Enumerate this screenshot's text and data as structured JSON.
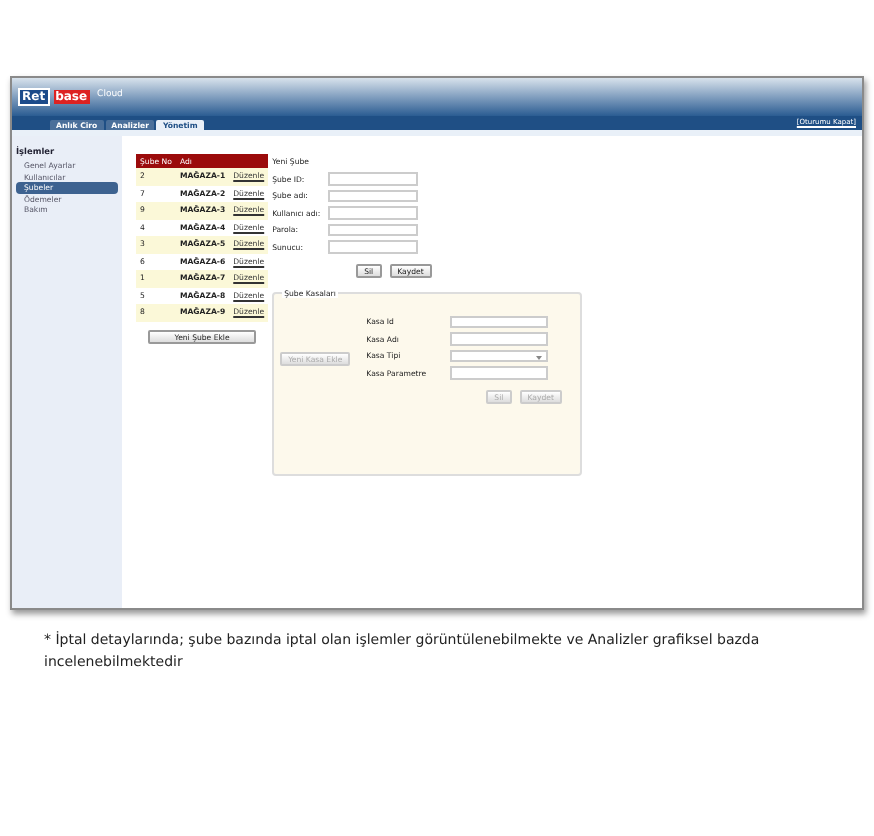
{
  "header": {
    "logo_box": "Ret",
    "logo_rest": "base",
    "product": "Cloud",
    "logout": "[Oturumu Kapat]"
  },
  "tabs": [
    {
      "label": "Anlık Ciro",
      "selected": false
    },
    {
      "label": "Analizler",
      "selected": false
    },
    {
      "label": "Yönetim",
      "selected": true
    }
  ],
  "sidebar": {
    "title": "İşlemler",
    "items": [
      {
        "label": "Genel Ayarlar",
        "selected": false
      },
      {
        "label": "Kullanıcılar",
        "selected": false
      },
      {
        "label": "Şubeler",
        "selected": true
      },
      {
        "label": "Ödemeler",
        "selected": false
      },
      {
        "label": "Bakım",
        "selected": false
      }
    ]
  },
  "table": {
    "columns": [
      "Şube No",
      "Adı"
    ],
    "rows": [
      {
        "no": "2",
        "name": "MAĞAZA-1",
        "action": "Düzenle"
      },
      {
        "no": "7",
        "name": "MAĞAZA-2",
        "action": "Düzenle"
      },
      {
        "no": "9",
        "name": "MAĞAZA-3",
        "action": "Düzenle"
      },
      {
        "no": "4",
        "name": "MAĞAZA-4",
        "action": "Düzenle"
      },
      {
        "no": "3",
        "name": "MAĞAZA-5",
        "action": "Düzenle"
      },
      {
        "no": "6",
        "name": "MAĞAZA-6",
        "action": "Düzenle"
      },
      {
        "no": "1",
        "name": "MAĞAZA-7",
        "action": "Düzenle"
      },
      {
        "no": "5",
        "name": "MAĞAZA-8",
        "action": "Düzenle"
      },
      {
        "no": "8",
        "name": "MAĞAZA-9",
        "action": "Düzenle"
      }
    ],
    "add_button": "Yeni Şube Ekle"
  },
  "branch_form": {
    "title": "Yeni Şube",
    "fields": [
      {
        "label": "Şube ID:"
      },
      {
        "label": "Şube adı:"
      },
      {
        "label": "Kullanıcı adı:"
      },
      {
        "label": "Parola:"
      },
      {
        "label": "Sunucu:"
      }
    ],
    "buttons": [
      {
        "label": "Sil",
        "disabled": false
      },
      {
        "label": "Kaydet",
        "disabled": false
      }
    ]
  },
  "registers": {
    "legend": "Şube Kasaları",
    "add_button": {
      "label": "Yeni Kasa Ekle",
      "disabled": true
    },
    "fields": [
      {
        "label": "Kasa Id",
        "kind": "text"
      },
      {
        "label": "Kasa Adı",
        "kind": "text"
      },
      {
        "label": "Kasa Tipi",
        "kind": "select"
      },
      {
        "label": "Kasa Parametre",
        "kind": "text"
      }
    ],
    "buttons": [
      {
        "label": "Sil",
        "disabled": true
      },
      {
        "label": "Kaydet",
        "disabled": true
      }
    ]
  },
  "caption": "* İptal detaylarında; şube bazında iptal olan işlemler görüntülenebilmekte ve Analizler grafiksel bazda incelenebilmektedir"
}
